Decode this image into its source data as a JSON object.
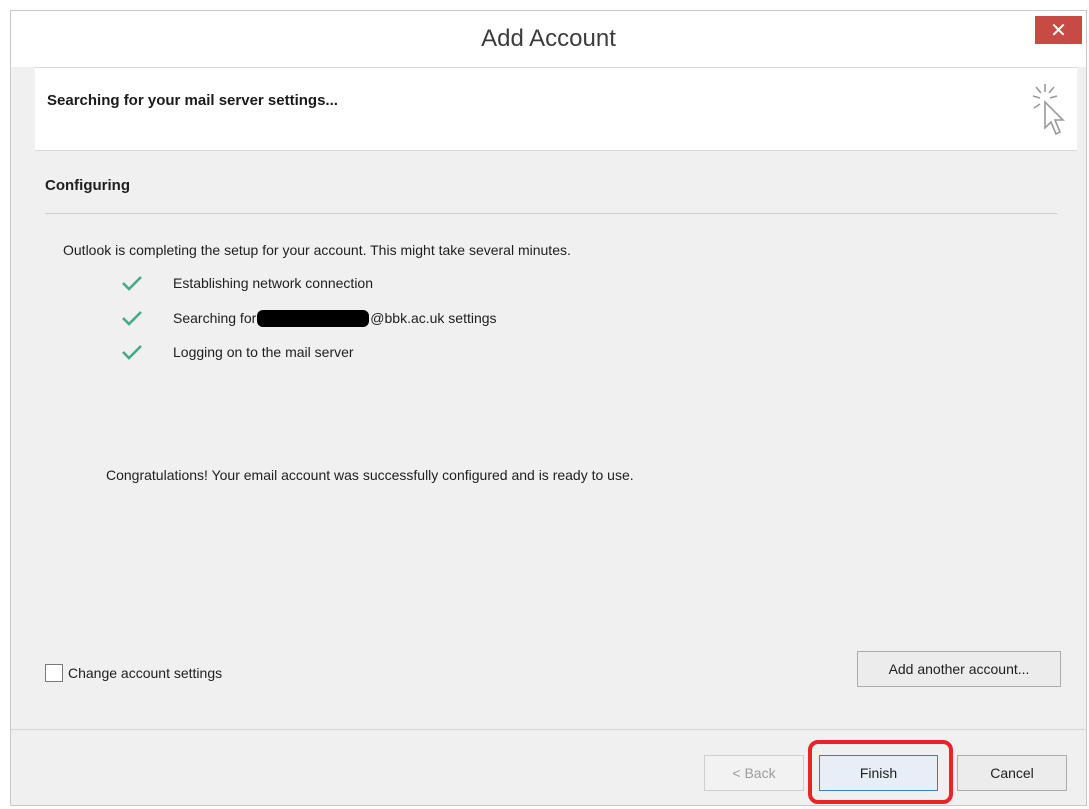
{
  "window": {
    "title": "Add Account",
    "close_glyph": "✕"
  },
  "header": {
    "title": "Searching for your mail server settings...",
    "icon": "busy-cursor-icon"
  },
  "section": {
    "title": "Configuring"
  },
  "intro": "Outlook is completing the setup for your account. This might take several minutes.",
  "steps": [
    {
      "label": "Establishing network connection",
      "status": "done"
    },
    {
      "label_prefix": "Searching for",
      "label_suffix": "@bbk.ac.uk settings",
      "status": "done",
      "redacted": true
    },
    {
      "label": "Logging on to the mail server",
      "status": "done"
    }
  ],
  "congrats": "Congratulations! Your email account was successfully configured and is ready to use.",
  "change_settings": {
    "label": "Change account settings",
    "checked": false
  },
  "buttons": {
    "add_another": "Add another account...",
    "back": "< Back",
    "finish": "Finish",
    "cancel": "Cancel"
  },
  "colors": {
    "check": "#4aa88a",
    "close_button": "#c84a45",
    "highlight": "#e8232a"
  }
}
